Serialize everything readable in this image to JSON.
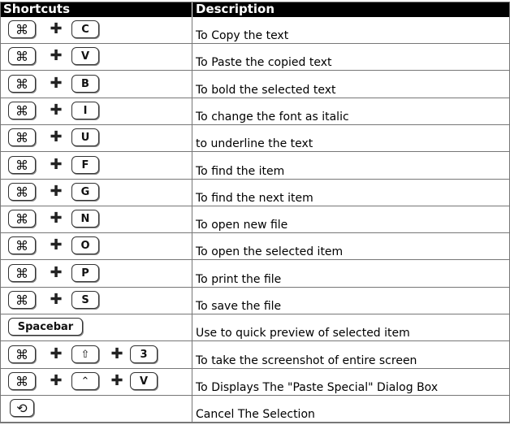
{
  "header": {
    "shortcuts": "Shortcuts",
    "description": "Description"
  },
  "rows": [
    {
      "keys": [
        "⌘",
        "C"
      ],
      "description": "To Copy the text"
    },
    {
      "keys": [
        "⌘",
        "V"
      ],
      "description": "To Paste the copied text"
    },
    {
      "keys": [
        "⌘",
        "B"
      ],
      "description": "To bold the selected text"
    },
    {
      "keys": [
        "⌘",
        "I"
      ],
      "description": "To change the font as italic"
    },
    {
      "keys": [
        "⌘",
        "U"
      ],
      "description": "to underline the text"
    },
    {
      "keys": [
        "⌘",
        "F"
      ],
      "description": "To find the item"
    },
    {
      "keys": [
        "⌘",
        "G"
      ],
      "description": "To find the next item"
    },
    {
      "keys": [
        "⌘",
        "N"
      ],
      "description": "To open new file"
    },
    {
      "keys": [
        "⌘",
        "O"
      ],
      "description": "To open the selected item"
    },
    {
      "keys": [
        "⌘",
        "P"
      ],
      "description": "To print the file"
    },
    {
      "keys": [
        "⌘",
        "S"
      ],
      "description": "To save the file"
    },
    {
      "keys": [
        "Spacebar"
      ],
      "description": "Use to quick preview of selected item"
    },
    {
      "keys": [
        "⌘",
        "⇧",
        "3"
      ],
      "description": "To take the screenshot of entire screen"
    },
    {
      "keys": [
        "⌘",
        "⌃",
        "V"
      ],
      "description": "To Displays The \"Paste Special\" Dialog Box"
    },
    {
      "keys": [
        "⟲"
      ],
      "description": "Cancel The Selection"
    }
  ],
  "icons": {
    "plus": "✚"
  }
}
